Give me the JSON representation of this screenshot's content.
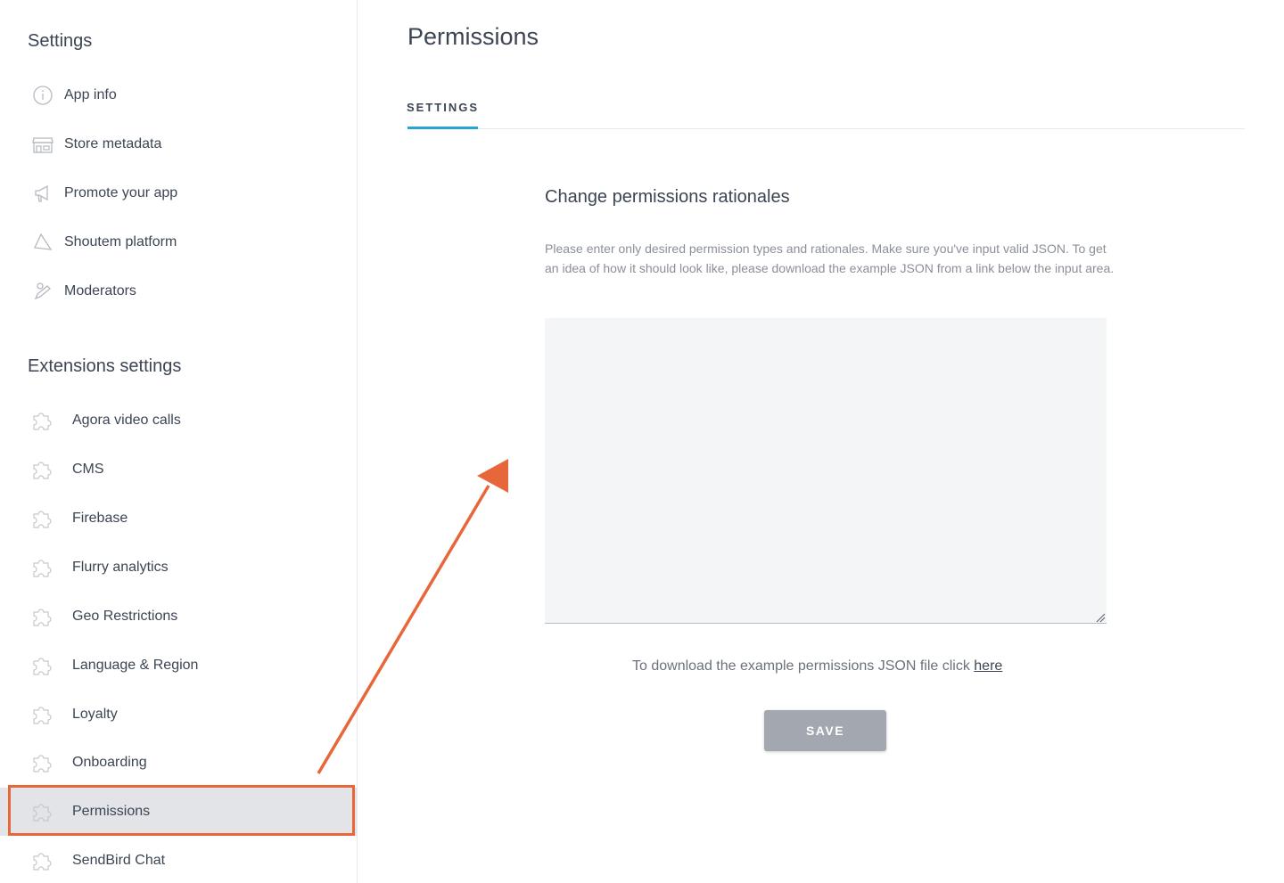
{
  "sidebar": {
    "settings_heading": "Settings",
    "app_items": [
      {
        "label": "App info",
        "icon": "info-icon"
      },
      {
        "label": "Store metadata",
        "icon": "store-icon"
      },
      {
        "label": "Promote your app",
        "icon": "megaphone-icon"
      },
      {
        "label": "Shoutem platform",
        "icon": "send-icon"
      },
      {
        "label": "Moderators",
        "icon": "pencil-icon"
      }
    ],
    "extensions_heading": "Extensions settings",
    "extension_items": [
      {
        "label": "Agora video calls",
        "icon": "puzzle-icon"
      },
      {
        "label": "CMS",
        "icon": "puzzle-icon"
      },
      {
        "label": "Firebase",
        "icon": "puzzle-icon"
      },
      {
        "label": "Flurry analytics",
        "icon": "puzzle-icon"
      },
      {
        "label": "Geo Restrictions",
        "icon": "puzzle-icon"
      },
      {
        "label": "Language & Region",
        "icon": "puzzle-icon"
      },
      {
        "label": "Loyalty",
        "icon": "puzzle-icon"
      },
      {
        "label": "Onboarding",
        "icon": "puzzle-icon"
      },
      {
        "label": "Permissions",
        "icon": "puzzle-icon",
        "active": true
      },
      {
        "label": "SendBird Chat",
        "icon": "puzzle-icon"
      }
    ]
  },
  "main": {
    "title": "Permissions",
    "tabs": [
      {
        "label": "SETTINGS",
        "active": true
      }
    ],
    "section_title": "Change permissions rationales",
    "description": "Please enter only desired permission types and rationales. Make sure you've input valid JSON. To get an idea of how it should look like, please download the example JSON from a link below the input area.",
    "json_value": "",
    "download_text": "To download the example permissions JSON file click ",
    "download_link": "here",
    "save_label": "SAVE"
  },
  "colors": {
    "accent": "#27a5d6",
    "annotation": "#e8673a",
    "active_item_bg": "#e3e4e8",
    "save_button": "#a3a7b0"
  }
}
